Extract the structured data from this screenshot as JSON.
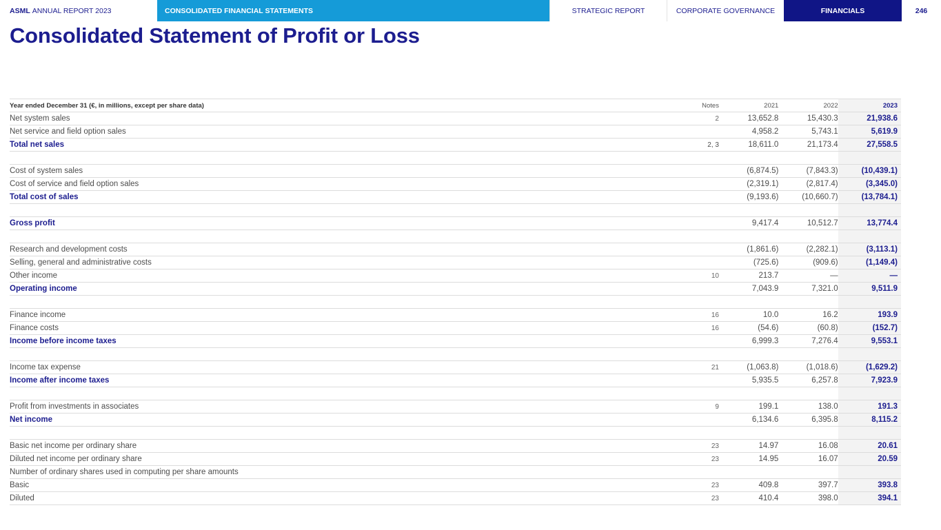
{
  "header": {
    "brand": "ASML",
    "report": "ANNUAL REPORT 2023",
    "section": "CONSOLIDATED FINANCIAL STATEMENTS",
    "nav": [
      {
        "label": "STRATEGIC REPORT",
        "active": false
      },
      {
        "label": "CORPORATE GOVERNANCE",
        "active": false
      },
      {
        "label": "FINANCIALS",
        "active": true
      }
    ],
    "page_number": "246"
  },
  "title": "Consolidated Statement of Profit or Loss",
  "table": {
    "header": {
      "label": "Year ended December 31 (€, in millions, except per share data)",
      "notes": "Notes",
      "y2021": "2021",
      "y2022": "2022",
      "y2023": "2023"
    },
    "rows": [
      {
        "label": "Net system sales",
        "notes": "2",
        "y2021": "13,652.8",
        "y2022": "15,430.3",
        "y2023": "21,938.6"
      },
      {
        "label": "Net service and field option sales",
        "notes": "",
        "y2021": "4,958.2",
        "y2022": "5,743.1",
        "y2023": "5,619.9"
      },
      {
        "label": "Total net sales",
        "notes": "2, 3",
        "y2021": "18,611.0",
        "y2022": "21,173.4",
        "y2023": "27,558.5"
      },
      {
        "label": "",
        "notes": "",
        "y2021": "",
        "y2022": "",
        "y2023": ""
      },
      {
        "label": "Cost of system sales",
        "notes": "",
        "y2021": "(6,874.5)",
        "y2022": "(7,843.3)",
        "y2023": "(10,439.1)"
      },
      {
        "label": "Cost of service and field option sales",
        "notes": "",
        "y2021": "(2,319.1)",
        "y2022": "(2,817.4)",
        "y2023": "(3,345.0)"
      },
      {
        "label": "Total cost of sales",
        "notes": "",
        "y2021": "(9,193.6)",
        "y2022": "(10,660.7)",
        "y2023": "(13,784.1)"
      },
      {
        "label": "",
        "notes": "",
        "y2021": "",
        "y2022": "",
        "y2023": ""
      },
      {
        "label": "Gross profit",
        "notes": "",
        "y2021": "9,417.4",
        "y2022": "10,512.7",
        "y2023": "13,774.4"
      },
      {
        "label": "",
        "notes": "",
        "y2021": "",
        "y2022": "",
        "y2023": ""
      },
      {
        "label": "Research and development costs",
        "notes": "",
        "y2021": "(1,861.6)",
        "y2022": "(2,282.1)",
        "y2023": "(3,113.1)"
      },
      {
        "label": "Selling, general and administrative costs",
        "notes": "",
        "y2021": "(725.6)",
        "y2022": "(909.6)",
        "y2023": "(1,149.4)"
      },
      {
        "label": "Other income",
        "notes": "10",
        "y2021": "213.7",
        "y2022": "—",
        "y2023": "—"
      },
      {
        "label": "Operating income",
        "notes": "",
        "y2021": "7,043.9",
        "y2022": "7,321.0",
        "y2023": "9,511.9"
      },
      {
        "label": "",
        "notes": "",
        "y2021": "",
        "y2022": "",
        "y2023": ""
      },
      {
        "label": "Finance income",
        "notes": "16",
        "y2021": "10.0",
        "y2022": "16.2",
        "y2023": "193.9"
      },
      {
        "label": "Finance costs",
        "notes": "16",
        "y2021": "(54.6)",
        "y2022": "(60.8)",
        "y2023": "(152.7)"
      },
      {
        "label": "Income before income taxes",
        "notes": "",
        "y2021": "6,999.3",
        "y2022": "7,276.4",
        "y2023": "9,553.1"
      },
      {
        "label": "",
        "notes": "",
        "y2021": "",
        "y2022": "",
        "y2023": ""
      },
      {
        "label": "Income tax expense",
        "notes": "21",
        "y2021": "(1,063.8)",
        "y2022": "(1,018.6)",
        "y2023": "(1,629.2)"
      },
      {
        "label": "Income after income taxes",
        "notes": "",
        "y2021": "5,935.5",
        "y2022": "6,257.8",
        "y2023": "7,923.9"
      },
      {
        "label": "",
        "notes": "",
        "y2021": "",
        "y2022": "",
        "y2023": ""
      },
      {
        "label": "Profit from investments in associates",
        "notes": "9",
        "y2021": "199.1",
        "y2022": "138.0",
        "y2023": "191.3"
      },
      {
        "label": "Net income",
        "notes": "",
        "y2021": "6,134.6",
        "y2022": "6,395.8",
        "y2023": "8,115.2"
      },
      {
        "label": "",
        "notes": "",
        "y2021": "",
        "y2022": "",
        "y2023": ""
      },
      {
        "label": "Basic net income per ordinary share",
        "notes": "23",
        "y2021": "14.97",
        "y2022": "16.08",
        "y2023": "20.61"
      },
      {
        "label": "Diluted net income per ordinary share",
        "notes": "23",
        "y2021": "14.95",
        "y2022": "16.07",
        "y2023": "20.59"
      },
      {
        "label": "Number of ordinary shares used in computing per share amounts",
        "notes": "",
        "y2021": "",
        "y2022": "",
        "y2023": ""
      },
      {
        "label": "Basic",
        "notes": "23",
        "y2021": "409.8",
        "y2022": "397.7",
        "y2023": "393.8"
      },
      {
        "label": "Diluted",
        "notes": "23",
        "y2021": "410.4",
        "y2022": "398.0",
        "y2023": "394.1"
      }
    ]
  }
}
